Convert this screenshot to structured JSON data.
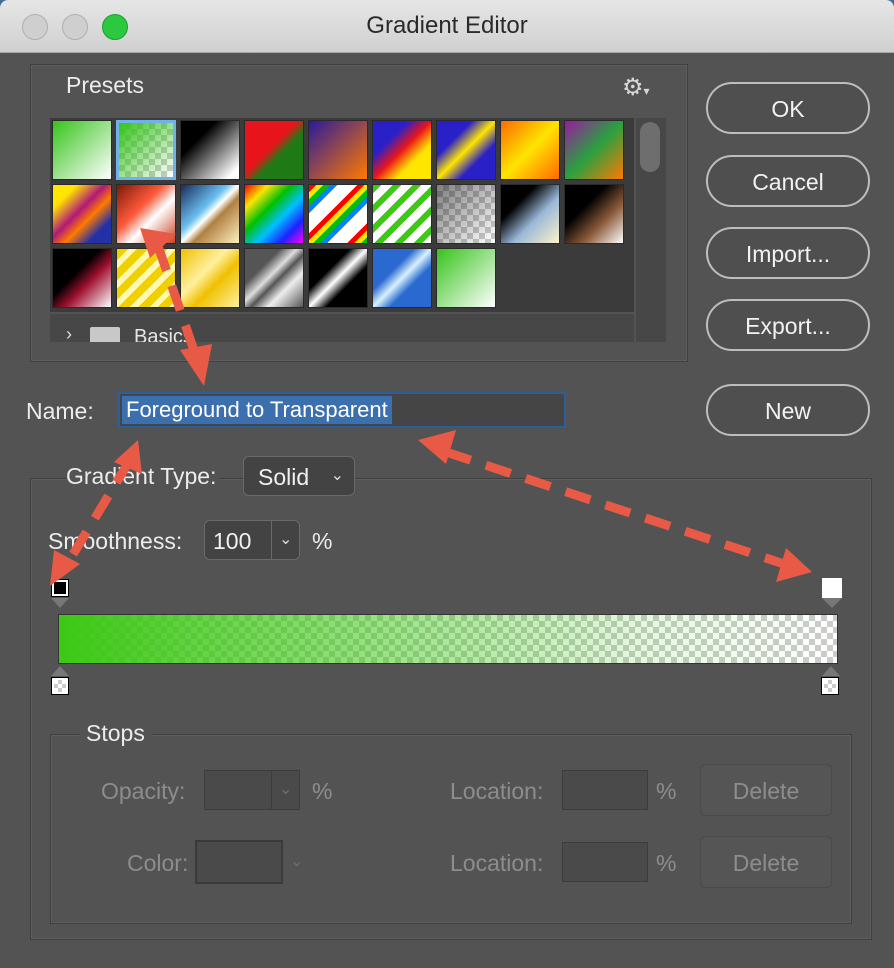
{
  "window": {
    "title": "Gradient Editor"
  },
  "presets": {
    "label": "Presets",
    "folder_label": "Basics",
    "swatches": [
      {
        "name": "green-white"
      },
      {
        "name": "green-transparent-selected"
      },
      {
        "name": "black-white"
      },
      {
        "name": "red-green"
      },
      {
        "name": "violet-orange"
      },
      {
        "name": "blue-red-yellow"
      },
      {
        "name": "blue-yellow-blue"
      },
      {
        "name": "orange-yellow-orange"
      },
      {
        "name": "violet-green-orange"
      },
      {
        "name": "yellow-violet-orange-blue"
      },
      {
        "name": "copper"
      },
      {
        "name": "chrome"
      },
      {
        "name": "spectrum"
      },
      {
        "name": "transparent-rainbow"
      },
      {
        "name": "transparent-stripes"
      },
      {
        "name": "neutral-density"
      },
      {
        "name": "blue-cream"
      },
      {
        "name": "sepia-white"
      },
      {
        "name": "black-red-white"
      },
      {
        "name": "yellow-stripes"
      },
      {
        "name": "gold"
      },
      {
        "name": "steel"
      },
      {
        "name": "black-white-black"
      },
      {
        "name": "blue-silver"
      },
      {
        "name": "green-white-2"
      }
    ]
  },
  "buttons": {
    "ok": "OK",
    "cancel": "Cancel",
    "import": "Import...",
    "export": "Export...",
    "new": "New"
  },
  "name": {
    "label": "Name:",
    "value": "Foreground to Transparent"
  },
  "gradient_type": {
    "label": "Gradient Type:",
    "value": "Solid"
  },
  "smoothness": {
    "label": "Smoothness:",
    "value": "100",
    "unit": "%"
  },
  "gradient": {
    "color": "#3cc814"
  },
  "stops": {
    "label": "Stops",
    "opacity_label": "Opacity:",
    "opacity_unit": "%",
    "color_label": "Color:",
    "location_label": "Location:",
    "location_unit": "%",
    "delete_label": "Delete"
  },
  "colors": {
    "arrow": "#e85a45",
    "selection": "#3c6fad"
  }
}
